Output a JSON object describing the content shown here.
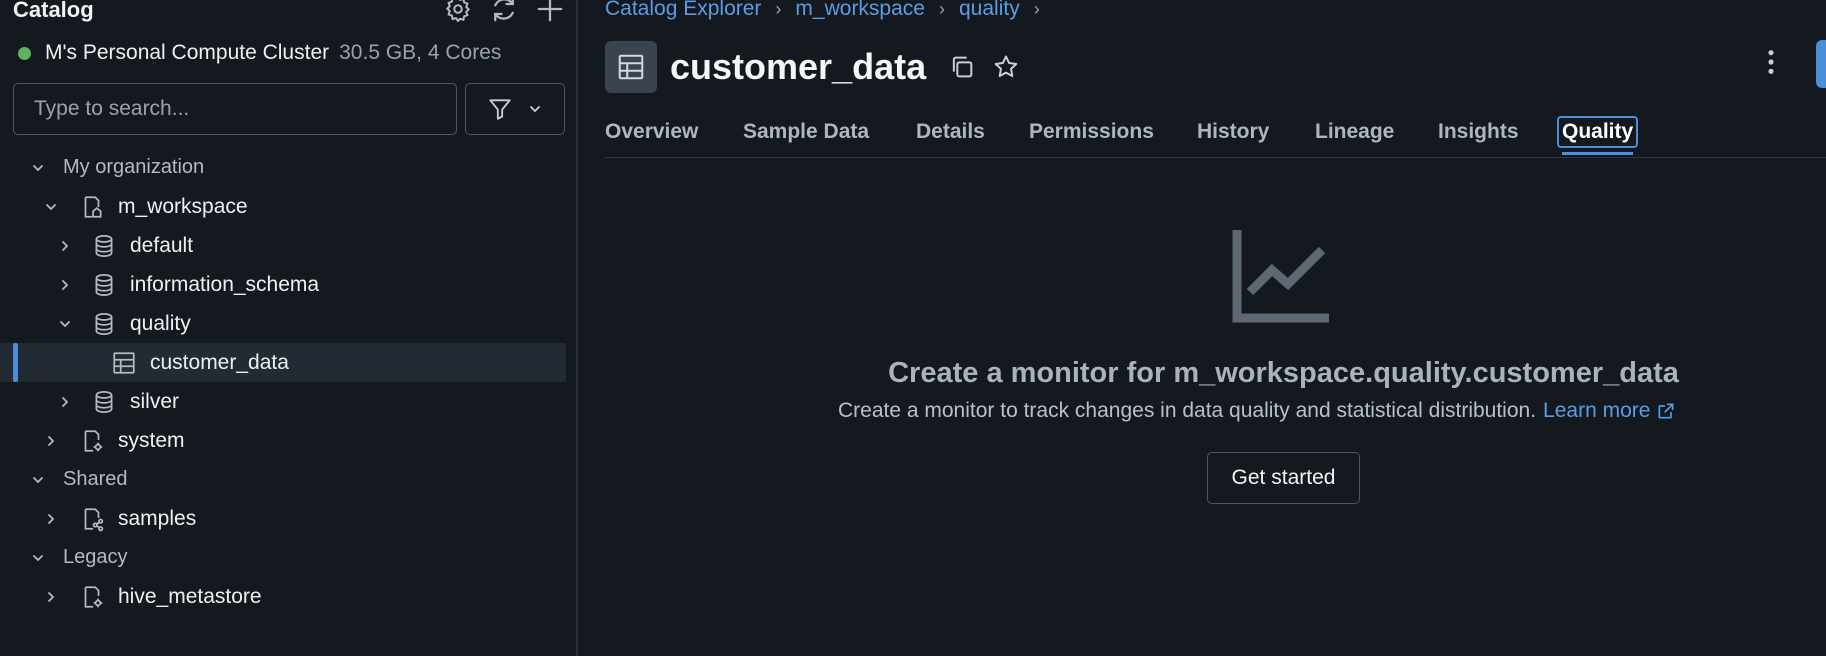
{
  "sidebar": {
    "title": "Catalog",
    "cluster": {
      "name": "M's Personal Compute Cluster",
      "spec": "30.5 GB, 4 Cores",
      "status_color": "#5fb35f"
    },
    "search": {
      "placeholder": "Type to search...",
      "value": ""
    },
    "tree": {
      "my_org": "My organization",
      "m_workspace": "m_workspace",
      "default": "default",
      "information_schema": "information_schema",
      "quality": "quality",
      "customer_data": "customer_data",
      "silver": "silver",
      "system": "system",
      "shared": "Shared",
      "samples": "samples",
      "legacy": "Legacy",
      "hive_metastore": "hive_metastore"
    }
  },
  "breadcrumb": [
    "Catalog Explorer",
    "m_workspace",
    "quality"
  ],
  "page_title": "customer_data",
  "tabs": [
    "Overview",
    "Sample Data",
    "Details",
    "Permissions",
    "History",
    "Lineage",
    "Insights",
    "Quality"
  ],
  "active_tab": "Quality",
  "empty_state": {
    "title": "Create a monitor for m_workspace.quality.customer_data",
    "description": "Create a monitor to track changes in data quality and statistical distribution.",
    "link": "Learn more",
    "button": "Get started"
  },
  "colors": {
    "accent": "#4c8ed9",
    "link": "#5a9de6",
    "background": "#13191f"
  }
}
